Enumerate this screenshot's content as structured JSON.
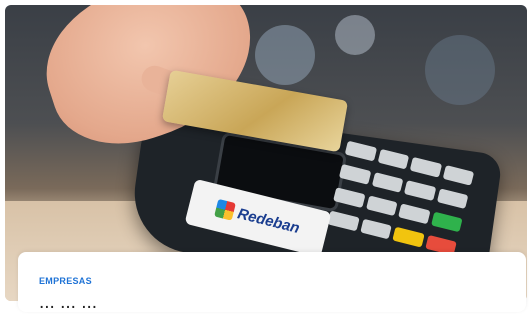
{
  "card": {
    "category": "EMPRESAS",
    "brand_name": "Redeban",
    "headline": "... ... ..."
  }
}
